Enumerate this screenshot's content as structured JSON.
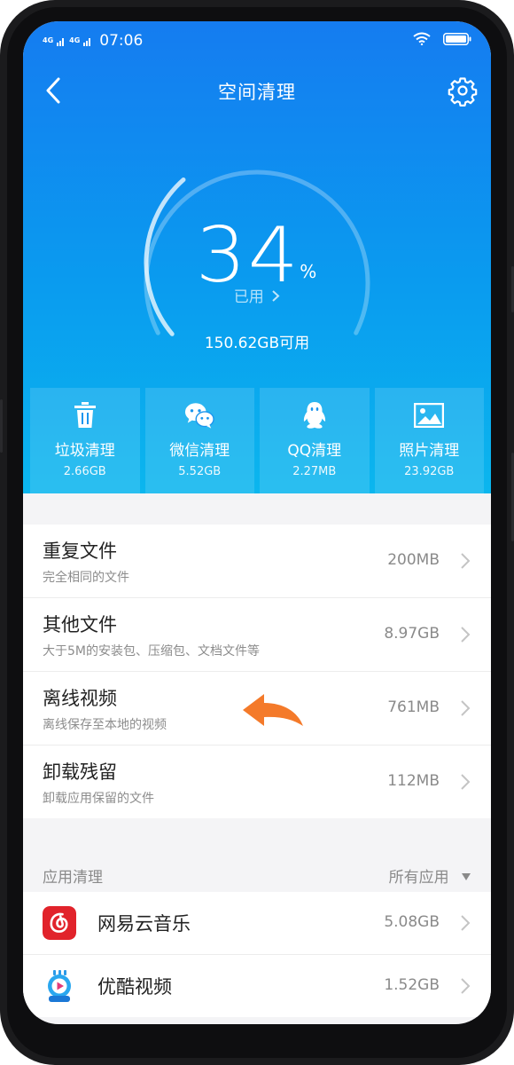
{
  "status": {
    "signal_1": "4G",
    "signal_2": "4G",
    "time": "07:06"
  },
  "header": {
    "title": "空间清理"
  },
  "usage": {
    "percent": "34",
    "percent_sign": "%",
    "used_label": "已用",
    "available": "150.62GB可用",
    "used_fraction": 0.34
  },
  "tiles": [
    {
      "name": "垃圾清理",
      "size": "2.66GB",
      "icon": "trash-icon"
    },
    {
      "name": "微信清理",
      "size": "5.52GB",
      "icon": "wechat-icon"
    },
    {
      "name": "QQ清理",
      "size": "2.27MB",
      "icon": "qq-penguin-icon"
    },
    {
      "name": "照片清理",
      "size": "23.92GB",
      "icon": "photo-icon"
    }
  ],
  "files": [
    {
      "title": "重复文件",
      "subtitle": "完全相同的文件",
      "size": "200MB"
    },
    {
      "title": "其他文件",
      "subtitle": "大于5M的安装包、压缩包、文档文件等",
      "size": "8.97GB"
    },
    {
      "title": "离线视频",
      "subtitle": "离线保存至本地的视频",
      "size": "761MB"
    },
    {
      "title": "卸载残留",
      "subtitle": "卸载应用保留的文件",
      "size": "112MB"
    }
  ],
  "apps": {
    "section_label": "应用清理",
    "filter_label": "所有应用",
    "items": [
      {
        "name": "网易云音乐",
        "size": "5.08GB",
        "icon": "netease-music-icon"
      },
      {
        "name": "优酷视频",
        "size": "1.52GB",
        "icon": "youku-icon"
      }
    ]
  },
  "colors": {
    "hero_top": "#157cf0",
    "hero_bottom": "#0bb6ee",
    "pointer_arrow": "#f47a2a",
    "netease_red": "#e1232b"
  }
}
